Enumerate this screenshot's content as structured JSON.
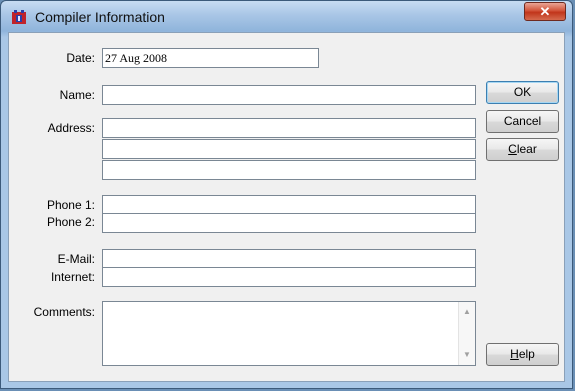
{
  "window": {
    "title": "Compiler Information",
    "close_label": "✕"
  },
  "labels": {
    "date": "Date:",
    "name": "Name:",
    "address": "Address:",
    "phone1": "Phone 1:",
    "phone2": "Phone 2:",
    "email": "E-Mail:",
    "internet": "Internet:",
    "comments": "Comments:"
  },
  "values": {
    "date": "27 Aug 2008",
    "name": "",
    "address1": "",
    "address2": "",
    "address3": "",
    "phone1": "",
    "phone2": "",
    "email": "",
    "internet": "",
    "comments": ""
  },
  "buttons": {
    "ok": "OK",
    "cancel": "Cancel",
    "clear_underlined": "C",
    "clear_rest": "lear",
    "help_underlined": "H",
    "help_rest": "elp"
  },
  "icons": {
    "app": "app-icon",
    "close": "close-icon",
    "scroll_up": "scroll-up-arrow-icon",
    "scroll_down": "scroll-down-arrow-icon"
  }
}
